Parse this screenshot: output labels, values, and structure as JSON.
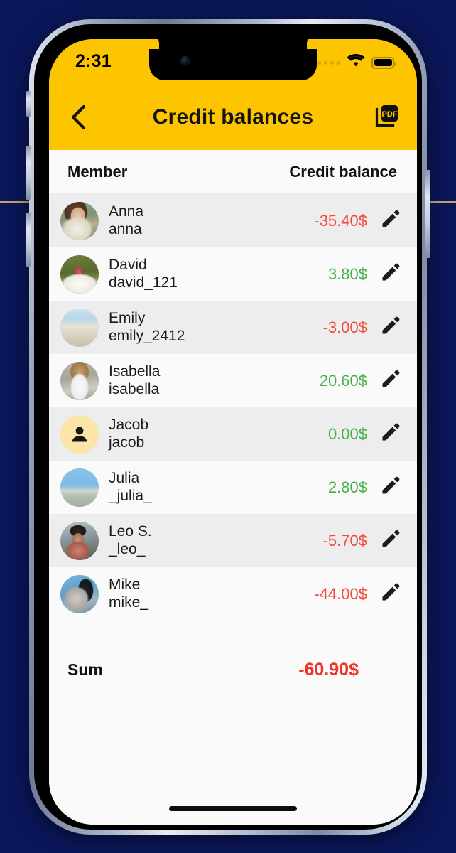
{
  "status_bar": {
    "time": "2:31",
    "signal_icon": "signal-dots-icon",
    "wifi_icon": "wifi-icon",
    "battery_icon": "battery-full-icon"
  },
  "app_bar": {
    "back_icon": "chevron-left-icon",
    "title": "Credit balances",
    "pdf_icon": "pdf-export-icon",
    "pdf_label": "PDF",
    "background_color": "#FDC500"
  },
  "list_header": {
    "member_label": "Member",
    "balance_label": "Credit balance"
  },
  "rows": [
    {
      "name": "Anna",
      "username": "anna",
      "amount": "-35.40$",
      "sign": "neg",
      "avatar": "photo",
      "avatar_class": "ph-anna",
      "edit_icon": "pencil-icon"
    },
    {
      "name": "David",
      "username": "david_121",
      "amount": "3.80$",
      "sign": "pos",
      "avatar": "photo",
      "avatar_class": "ph-david",
      "edit_icon": "pencil-icon"
    },
    {
      "name": "Emily",
      "username": "emily_2412",
      "amount": "-3.00$",
      "sign": "neg",
      "avatar": "photo",
      "avatar_class": "ph-emily",
      "edit_icon": "pencil-icon"
    },
    {
      "name": "Isabella",
      "username": "isabella",
      "amount": "20.60$",
      "sign": "pos",
      "avatar": "photo",
      "avatar_class": "ph-isabella",
      "edit_icon": "pencil-icon"
    },
    {
      "name": "Jacob",
      "username": "jacob",
      "amount": "0.00$",
      "sign": "pos",
      "avatar": "default",
      "avatar_class": "ph-default",
      "edit_icon": "pencil-icon"
    },
    {
      "name": "Julia",
      "username": "_julia_",
      "amount": "2.80$",
      "sign": "pos",
      "avatar": "photo",
      "avatar_class": "ph-julia",
      "edit_icon": "pencil-icon"
    },
    {
      "name": "Leo S.",
      "username": "_leo_",
      "amount": "-5.70$",
      "sign": "neg",
      "avatar": "photo",
      "avatar_class": "ph-leo",
      "edit_icon": "pencil-icon"
    },
    {
      "name": "Mike",
      "username": "mike_",
      "amount": "-44.00$",
      "sign": "neg",
      "avatar": "photo",
      "avatar_class": "ph-mike",
      "edit_icon": "pencil-icon"
    }
  ],
  "summary": {
    "label": "Sum",
    "value": "-60.90$",
    "sign": "neg"
  },
  "colors": {
    "accent_yellow": "#FDC500",
    "negative_red": "#F4483C",
    "positive_green": "#43B149",
    "sum_red": "#F03227",
    "row_light": "#FAFAFA",
    "row_shaded": "#EDEDED",
    "backdrop_navy": "#0B1659"
  },
  "home_indicator": "home-indicator"
}
